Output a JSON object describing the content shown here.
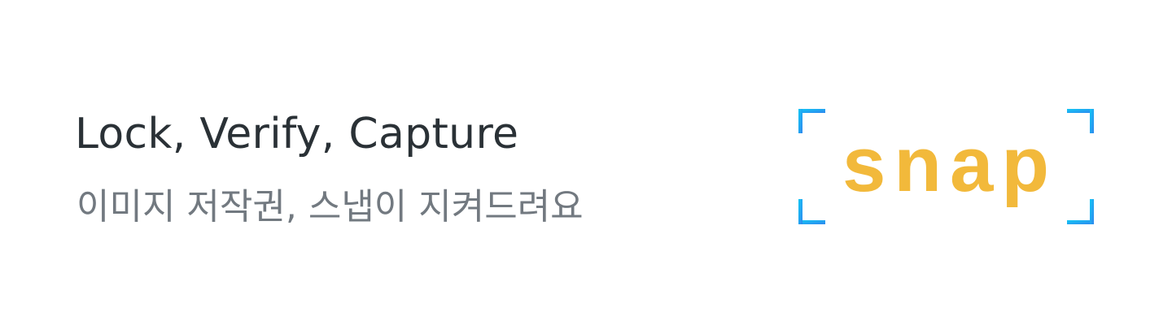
{
  "banner": {
    "headline": "Lock, Verify, Capture",
    "subline": "이미지 저작권, 스냅이 지켜드려요"
  },
  "logo": {
    "wordmark": "snap",
    "wordmark_color": "#f2b93b",
    "frame_color_start": "#13c8f5",
    "frame_color_end": "#2f87ee",
    "frame_icon": "viewfinder-corners-icon"
  }
}
